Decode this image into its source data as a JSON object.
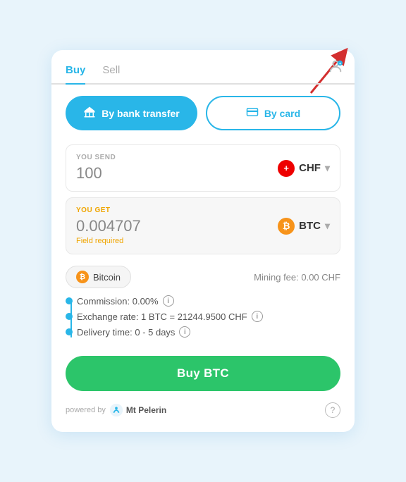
{
  "tabs": {
    "buy_label": "Buy",
    "sell_label": "Sell",
    "active": "buy"
  },
  "payment": {
    "bank_transfer_label": "By bank transfer",
    "card_label": "By card"
  },
  "send": {
    "label": "YOU SEND",
    "value": "100",
    "currency_code": "CHF"
  },
  "get": {
    "label": "YOU GET",
    "value": "0.004707",
    "currency_code": "BTC",
    "field_required": "Field required"
  },
  "coin": {
    "name": "Bitcoin",
    "mining_fee_label": "Mining fee: 0.00 CHF"
  },
  "info": {
    "commission": "Commission: 0.00%",
    "exchange_rate": "Exchange rate: 1 BTC = 21244.9500 CHF",
    "delivery_time": "Delivery time: 0 - 5 days"
  },
  "buy_button": {
    "label": "Buy BTC"
  },
  "footer": {
    "powered_by": "powered by",
    "brand": "Mt Pelerin"
  }
}
